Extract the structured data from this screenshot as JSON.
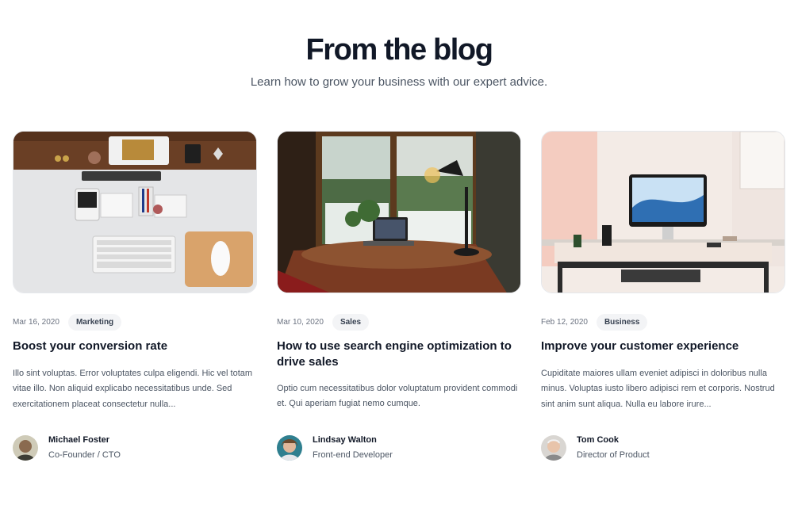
{
  "header": {
    "title": "From the blog",
    "subtitle": "Learn how to grow your business with our expert advice."
  },
  "posts": [
    {
      "date": "Mar 16, 2020",
      "category": "Marketing",
      "title": "Boost your conversion rate",
      "excerpt": "Illo sint voluptas. Error voluptates culpa eligendi. Hic vel totam vitae illo. Non aliquid explicabo necessitatibus unde. Sed exercitationem placeat consectetur nulla...",
      "author": {
        "name": "Michael Foster",
        "role": "Co-Founder / CTO"
      },
      "image": "desk-top-view-photo"
    },
    {
      "date": "Mar 10, 2020",
      "category": "Sales",
      "title": "How to use search engine optimization to drive sales",
      "excerpt": "Optio cum necessitatibus dolor voluptatum provident commodi et. Qui aperiam fugiat nemo cumque.",
      "author": {
        "name": "Lindsay Walton",
        "role": "Front-end Developer"
      },
      "image": "window-desk-laptop-photo"
    },
    {
      "date": "Feb 12, 2020",
      "category": "Business",
      "title": "Improve your customer experience",
      "excerpt": "Cupiditate maiores ullam eveniet adipisci in doloribus nulla minus. Voluptas iusto libero adipisci rem et corporis. Nostrud sint anim sunt aliqua. Nulla eu labore irure...",
      "author": {
        "name": "Tom Cook",
        "role": "Director of Product"
      },
      "image": "imac-desk-photo"
    }
  ]
}
